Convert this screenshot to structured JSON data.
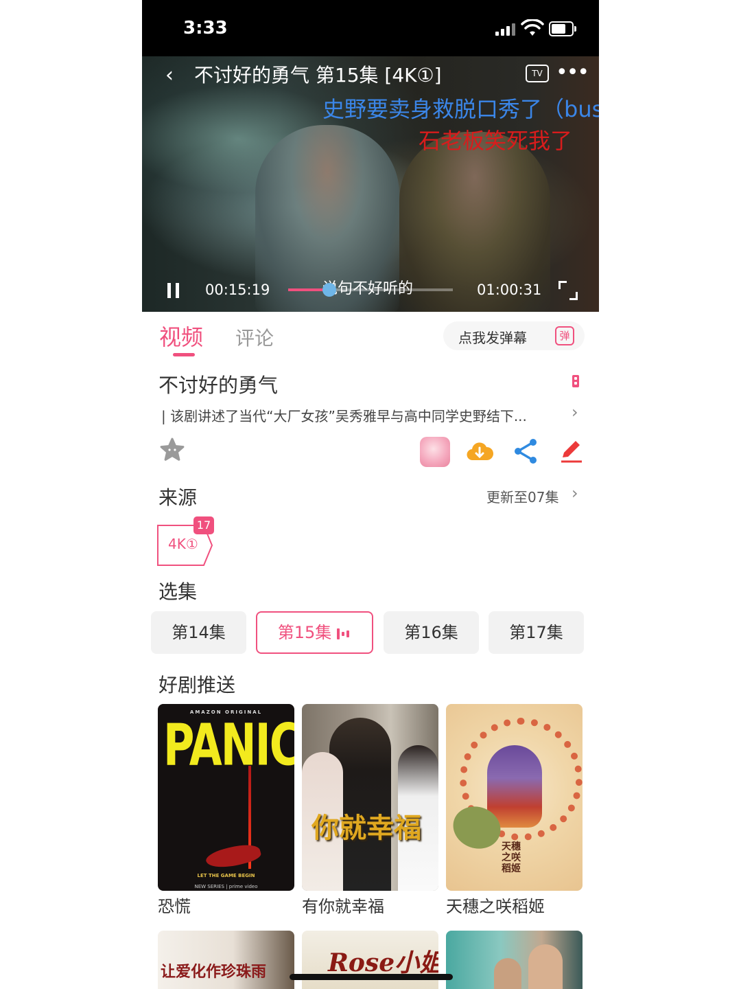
{
  "status_bar": {
    "time": "3:33"
  },
  "player": {
    "title": "不讨好的勇气 第15集 [4K①]",
    "tv_label": "TV",
    "danmaku": [
      "史野要卖身救脱口秀了（bus",
      "石老板笑死我了",
      "说句不好听的"
    ],
    "current_time": "00:15:19",
    "duration": "01:00:31",
    "progress": 0.25
  },
  "tabs": {
    "video": "视频",
    "comments": "评论"
  },
  "danmaku_button": {
    "label": "点我发弹幕",
    "icon_text": "弹"
  },
  "show": {
    "title": "不讨好的勇气",
    "synopsis": "| 该剧讲述了当代“大厂女孩”吴秀雅早与高中同学史野结下..."
  },
  "source": {
    "heading": "来源",
    "update_text": "更新至07集",
    "tag_label": "4K①",
    "tag_badge": "17"
  },
  "episodes": {
    "heading": "选集",
    "items": [
      {
        "label": "第14集",
        "active": false
      },
      {
        "label": "第15集",
        "active": true
      },
      {
        "label": "第16集",
        "active": false
      },
      {
        "label": "第17集",
        "active": false
      }
    ]
  },
  "recommend": {
    "heading": "好剧推送",
    "items": [
      {
        "name": "恐慌",
        "poster_text": "PANIC",
        "poster_top": "AMAZON ORIGINAL",
        "poster_sub": "LET THE GAME BEGIN",
        "poster_foot": "NEW SERIES | prime video"
      },
      {
        "name": "有你就幸福",
        "poster_text": "你就幸福"
      },
      {
        "name": "天穗之咲稻姬",
        "poster_text": "天穗之咲稻姬"
      }
    ],
    "more_posters": [
      {
        "poster_text": "让爱化作珍珠雨"
      },
      {
        "poster_text": "Rose小姐"
      },
      {
        "poster_text": ""
      }
    ]
  },
  "colors": {
    "accent": "#f0507e",
    "danmaku_blue": "#3b86e8",
    "danmaku_red": "#d81c1c"
  }
}
